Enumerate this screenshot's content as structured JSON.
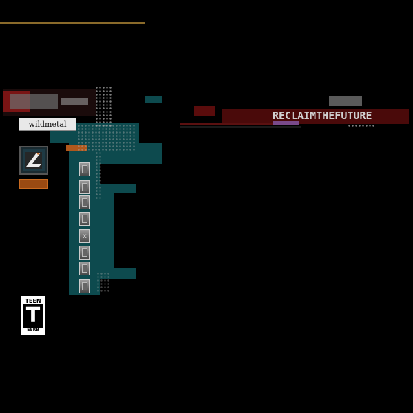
{
  "site": {
    "name": "wildmetal"
  },
  "banner": {
    "tagline": "RECLAIMTHEFUTURE"
  },
  "menu": {
    "buttons": [
      {
        "name": "menu-button-1",
        "glyph": ""
      },
      {
        "name": "menu-button-2",
        "glyph": ""
      },
      {
        "name": "menu-button-3",
        "glyph": ""
      },
      {
        "name": "menu-button-4",
        "glyph": ""
      },
      {
        "name": "menu-button-5",
        "glyph": "x"
      },
      {
        "name": "menu-button-6",
        "glyph": ""
      },
      {
        "name": "menu-button-7",
        "glyph": ""
      },
      {
        "name": "menu-button-8",
        "glyph": ""
      }
    ]
  },
  "rating": {
    "top": "TEEN",
    "letter": "T",
    "bottom": "ESRB"
  },
  "colors": {
    "teal": "#0d4a4e",
    "accent_red": "#4a0a0a",
    "orange": "#9a4a12"
  },
  "icons": {
    "logo": "l-logo-icon"
  }
}
